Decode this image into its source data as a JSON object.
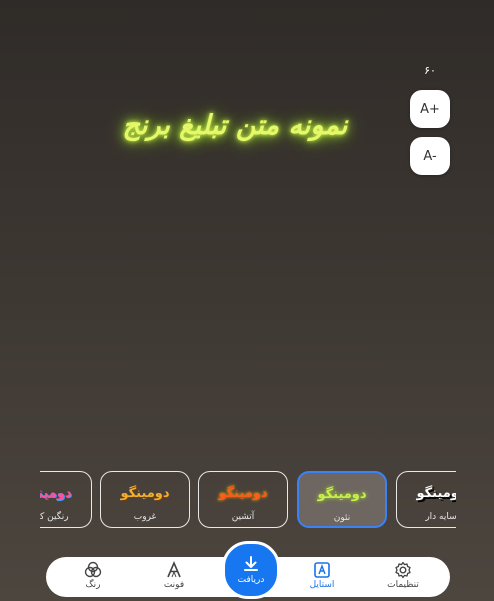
{
  "preview": {
    "text": "نمونه متن تبلیغ برنج",
    "color": "#e6f86a"
  },
  "size_controls": {
    "value": "۶۰",
    "increase_label": "A+",
    "decrease_label": "A-"
  },
  "styles": [
    {
      "sample": "دومینگو",
      "label": "رنگین کمان",
      "sample_color": "#ff4fa0"
    },
    {
      "sample": "دومینگو",
      "label": "غروب",
      "sample_color": "#f0b030"
    },
    {
      "sample": "دومینگو",
      "label": "آتشین",
      "sample_color": "#ff5a1a"
    },
    {
      "sample": "دومینگو",
      "label": "نئون",
      "sample_color": "#c8f04a",
      "selected": true
    },
    {
      "sample": "دومینگو",
      "label": "سایه دار",
      "sample_color": "#ffffff"
    }
  ],
  "bottom_nav": {
    "color": "رنگ",
    "font": "فونت",
    "download": "دریافت",
    "style": "استایل",
    "settings": "تنظیمات"
  },
  "accent": "#1677f0"
}
